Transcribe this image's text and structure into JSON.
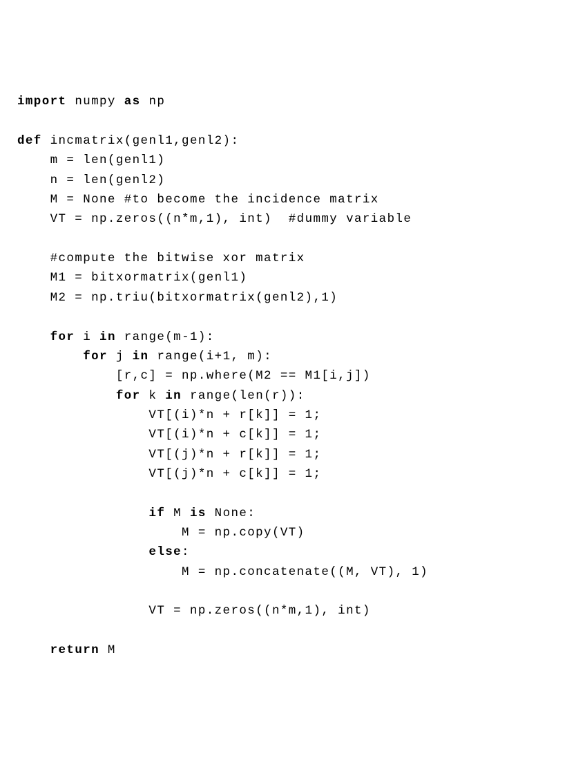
{
  "code": {
    "lines": [
      {
        "segments": [
          {
            "t": "import",
            "kw": true
          },
          {
            "t": " numpy "
          },
          {
            "t": "as",
            "kw": true
          },
          {
            "t": " np"
          }
        ]
      },
      {
        "segments": [
          {
            "t": ""
          }
        ]
      },
      {
        "segments": [
          {
            "t": "def",
            "kw": true
          },
          {
            "t": " incmatrix(genl1,genl2):"
          }
        ]
      },
      {
        "segments": [
          {
            "t": "    m = len(genl1)"
          }
        ]
      },
      {
        "segments": [
          {
            "t": "    n = len(genl2)"
          }
        ]
      },
      {
        "segments": [
          {
            "t": "    M = None "
          },
          {
            "t": "#to become the incidence matrix",
            "it": true
          }
        ]
      },
      {
        "segments": [
          {
            "t": "    VT = np.zeros((n*m,1), int)  "
          },
          {
            "t": "#dummy variable",
            "it": true
          }
        ]
      },
      {
        "segments": [
          {
            "t": ""
          }
        ]
      },
      {
        "segments": [
          {
            "t": "    "
          },
          {
            "t": "#compute the bitwise xor matrix",
            "it": true
          }
        ]
      },
      {
        "segments": [
          {
            "t": "    M1 = bitxormatrix(genl1)"
          }
        ]
      },
      {
        "segments": [
          {
            "t": "    M2 = np.triu(bitxormatrix(genl2),1)"
          }
        ]
      },
      {
        "segments": [
          {
            "t": ""
          }
        ]
      },
      {
        "segments": [
          {
            "t": "    "
          },
          {
            "t": "for",
            "kw": true
          },
          {
            "t": " i "
          },
          {
            "t": "in",
            "kw": true
          },
          {
            "t": " range(m-1):"
          }
        ]
      },
      {
        "segments": [
          {
            "t": "        "
          },
          {
            "t": "for",
            "kw": true
          },
          {
            "t": " j "
          },
          {
            "t": "in",
            "kw": true
          },
          {
            "t": " range(i+1, m):"
          }
        ]
      },
      {
        "segments": [
          {
            "t": "            [r,c] = np.where(M2 == M1[i,j])"
          }
        ]
      },
      {
        "segments": [
          {
            "t": "            "
          },
          {
            "t": "for",
            "kw": true
          },
          {
            "t": " k "
          },
          {
            "t": "in",
            "kw": true
          },
          {
            "t": " range(len(r)):"
          }
        ]
      },
      {
        "segments": [
          {
            "t": "                VT[(i)*n + r[k]] = 1;"
          }
        ]
      },
      {
        "segments": [
          {
            "t": "                VT[(i)*n + c[k]] = 1;"
          }
        ]
      },
      {
        "segments": [
          {
            "t": "                VT[(j)*n + r[k]] = 1;"
          }
        ]
      },
      {
        "segments": [
          {
            "t": "                VT[(j)*n + c[k]] = 1;"
          }
        ]
      },
      {
        "segments": [
          {
            "t": ""
          }
        ]
      },
      {
        "segments": [
          {
            "t": "                "
          },
          {
            "t": "if",
            "kw": true
          },
          {
            "t": " M "
          },
          {
            "t": "is",
            "kw": true
          },
          {
            "t": " None:"
          }
        ]
      },
      {
        "segments": [
          {
            "t": "                    M = np.copy(VT)"
          }
        ]
      },
      {
        "segments": [
          {
            "t": "                "
          },
          {
            "t": "else",
            "kw": true
          },
          {
            "t": ":"
          }
        ]
      },
      {
        "segments": [
          {
            "t": "                    M = np.concatenate((M, VT), 1)"
          }
        ]
      },
      {
        "segments": [
          {
            "t": ""
          }
        ]
      },
      {
        "segments": [
          {
            "t": "                VT = np.zeros((n*m,1), int)"
          }
        ]
      },
      {
        "segments": [
          {
            "t": ""
          }
        ]
      },
      {
        "segments": [
          {
            "t": "    "
          },
          {
            "t": "return",
            "kw": true
          },
          {
            "t": " M"
          }
        ]
      }
    ]
  }
}
